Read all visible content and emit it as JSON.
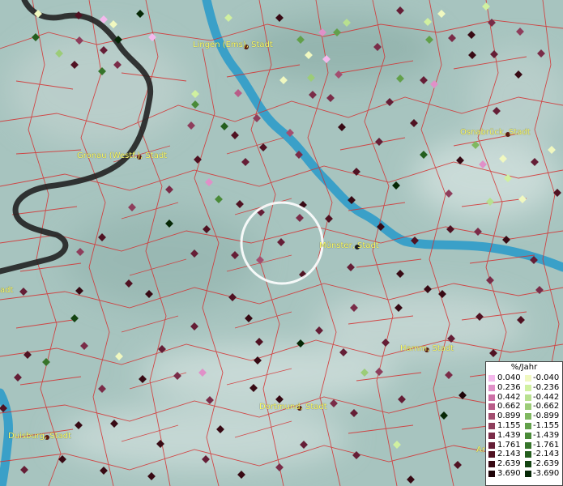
{
  "map": {
    "cities": [
      {
        "name": "Lingen (Ems), Stadt",
        "id": "lingen"
      },
      {
        "name": "Osnabrück, Stadt",
        "id": "osnabrueck"
      },
      {
        "name": "Gronau (Westf.), Stadt",
        "id": "gronau"
      },
      {
        "name": "Münster, Stadt",
        "id": "muenster"
      },
      {
        "name": "Hamm, Stadt",
        "id": "hamm"
      },
      {
        "name": "Dortmund, Stadt",
        "id": "dortmund"
      },
      {
        "name": "Duisburg, Stadt",
        "id": "duisburg"
      },
      {
        "name": "adt",
        "id": "left-cut"
      },
      {
        "name": "Ar",
        "id": "right-cut"
      }
    ],
    "colors": {
      "background": "#9fbfb9",
      "river": "#3aa0c8",
      "border": "#d43030",
      "national_border": "#222222",
      "city_label": "#ffff66",
      "selection_circle": "#ffffff"
    }
  },
  "legend": {
    "title": "%/Jahr",
    "positive": [
      {
        "value": "0.040",
        "color": "#f4b8ec"
      },
      {
        "value": "0.236",
        "color": "#e090c8"
      },
      {
        "value": "0.442",
        "color": "#cc70a6"
      },
      {
        "value": "0.662",
        "color": "#b85c88"
      },
      {
        "value": "0.899",
        "color": "#a34e70"
      },
      {
        "value": "1.155",
        "color": "#8e3e5c"
      },
      {
        "value": "1.439",
        "color": "#7a2c48"
      },
      {
        "value": "1.761",
        "color": "#651e36"
      },
      {
        "value": "2.143",
        "color": "#501222"
      },
      {
        "value": "2.639",
        "color": "#380a14"
      },
      {
        "value": "3.690",
        "color": "#1e0408"
      }
    ],
    "negative": [
      {
        "value": "-0.040",
        "color": "#f0f8c0"
      },
      {
        "value": "-0.236",
        "color": "#d0f0a0"
      },
      {
        "value": "-0.442",
        "color": "#b8e090"
      },
      {
        "value": "-0.662",
        "color": "#9ccc78"
      },
      {
        "value": "-0.899",
        "color": "#80b860"
      },
      {
        "value": "-1.155",
        "color": "#62a04a"
      },
      {
        "value": "-1.439",
        "color": "#4a8a38"
      },
      {
        "value": "-1.761",
        "color": "#36742a"
      },
      {
        "value": "-2.143",
        "color": "#245e1e"
      },
      {
        "value": "-2.639",
        "color": "#144412"
      },
      {
        "value": "-3.690",
        "color": "#062806"
      }
    ]
  }
}
